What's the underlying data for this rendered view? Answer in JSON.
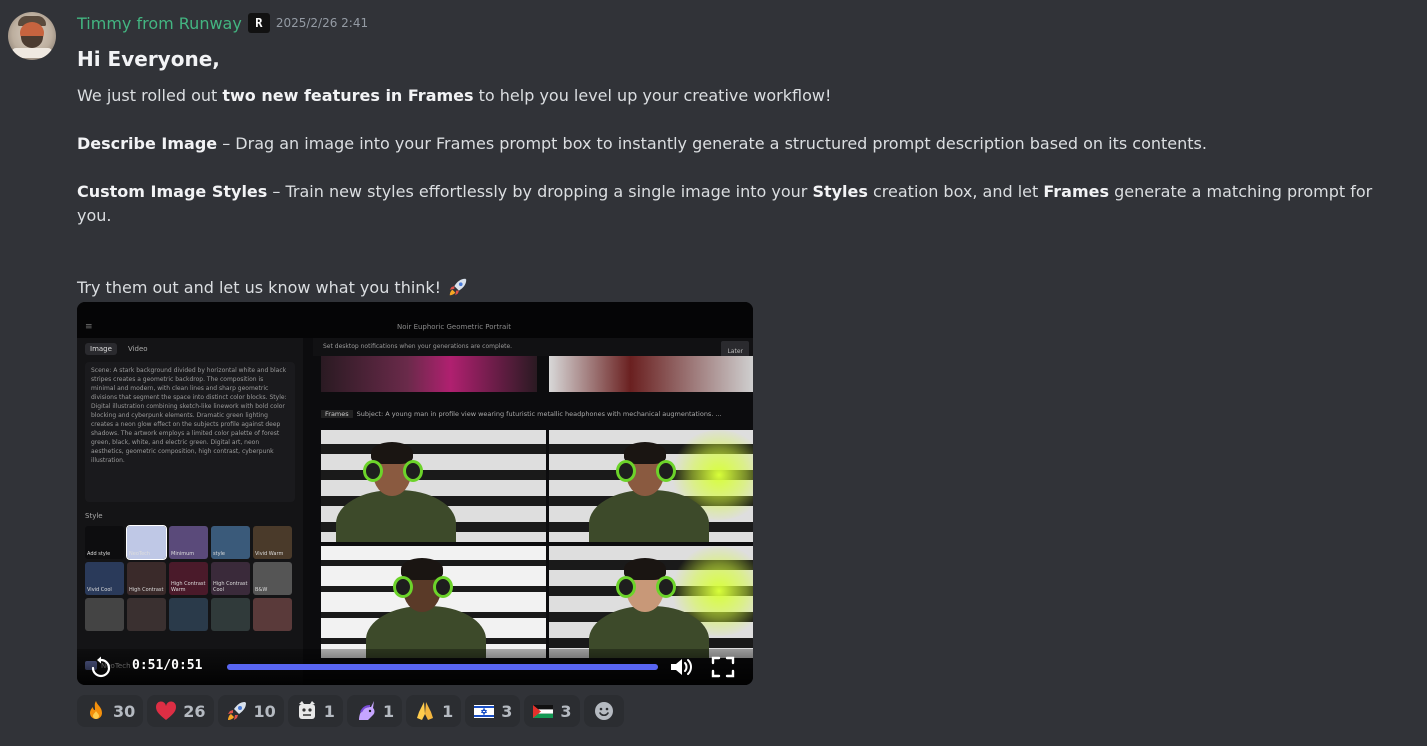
{
  "message": {
    "author": "Timmy from Runway",
    "badge": "R",
    "timestamp": "2025/2/26 2:41",
    "greeting": "Hi Everyone,",
    "p1_a": "We just rolled out ",
    "p1_b": "two new features in Frames",
    "p1_c": " to help you level up your creative workflow!",
    "p2_a": "Describe Image",
    "p2_b": " – Drag an image into your Frames prompt box to instantly generate a structured prompt description based on its contents.",
    "p3_a": "Custom Image Styles",
    "p3_b": " – Train new styles effortlessly by dropping a single image into your ",
    "p3_c": "Styles",
    "p3_d": " creation box, and let ",
    "p3_e": "Frames",
    "p3_f": " generate a matching prompt for you.",
    "p4": "Try them out and let us know what you think! "
  },
  "video": {
    "title": "Noir Euphoric Geometric Portrait",
    "tab_image": "Image",
    "tab_video": "Video",
    "description": "Scene: A stark background divided by horizontal white and black stripes creates a geometric backdrop. The composition is minimal and modern, with clean lines and sharp geometric divisions that segment the space into distinct color blocks. Style: Digital illustration combining sketch-like linework with bold color blocking and cyberpunk elements. Dramatic green lighting creates a neon glow effect on the subjects profile against deep shadows. The artwork employs a limited color palette of forest green, black, white, and electric green. Digital art, neon aesthetics, geometric composition, high contrast, cyberpunk illustration.",
    "style_label": "Style",
    "style_cells": [
      "Add style",
      "NeoTech",
      "Minimum",
      "style",
      "Vivid Warm",
      "Vivid Cool",
      "High Contrast",
      "High Contrast Warm",
      "High Contrast Cool",
      "B&W",
      "",
      "",
      "",
      "",
      ""
    ],
    "selected_style": "NeoTech",
    "notice": "Set desktop notifications when your generations are complete.",
    "later": "Later",
    "prompt_tag": "Frames",
    "prompt_text": "Subject: A young man in profile view wearing futuristic metallic headphones with mechanical augmentations. ...",
    "time": "0:51/0:51",
    "progress": 1.0
  },
  "reactions": [
    {
      "icon": "fire-icon",
      "count": "30"
    },
    {
      "icon": "heart-icon",
      "count": "26"
    },
    {
      "icon": "rocket-icon",
      "count": "10"
    },
    {
      "icon": "custom-emoji-icon",
      "count": "1"
    },
    {
      "icon": "custom-unicorn-icon",
      "count": "1"
    },
    {
      "icon": "folded-hands-icon",
      "count": "1"
    },
    {
      "icon": "flag-israel-icon",
      "count": "3"
    },
    {
      "icon": "flag-palestine-icon",
      "count": "3"
    }
  ],
  "colors": {
    "background": "#313338",
    "username": "#43b581",
    "accent": "#5865f2"
  }
}
